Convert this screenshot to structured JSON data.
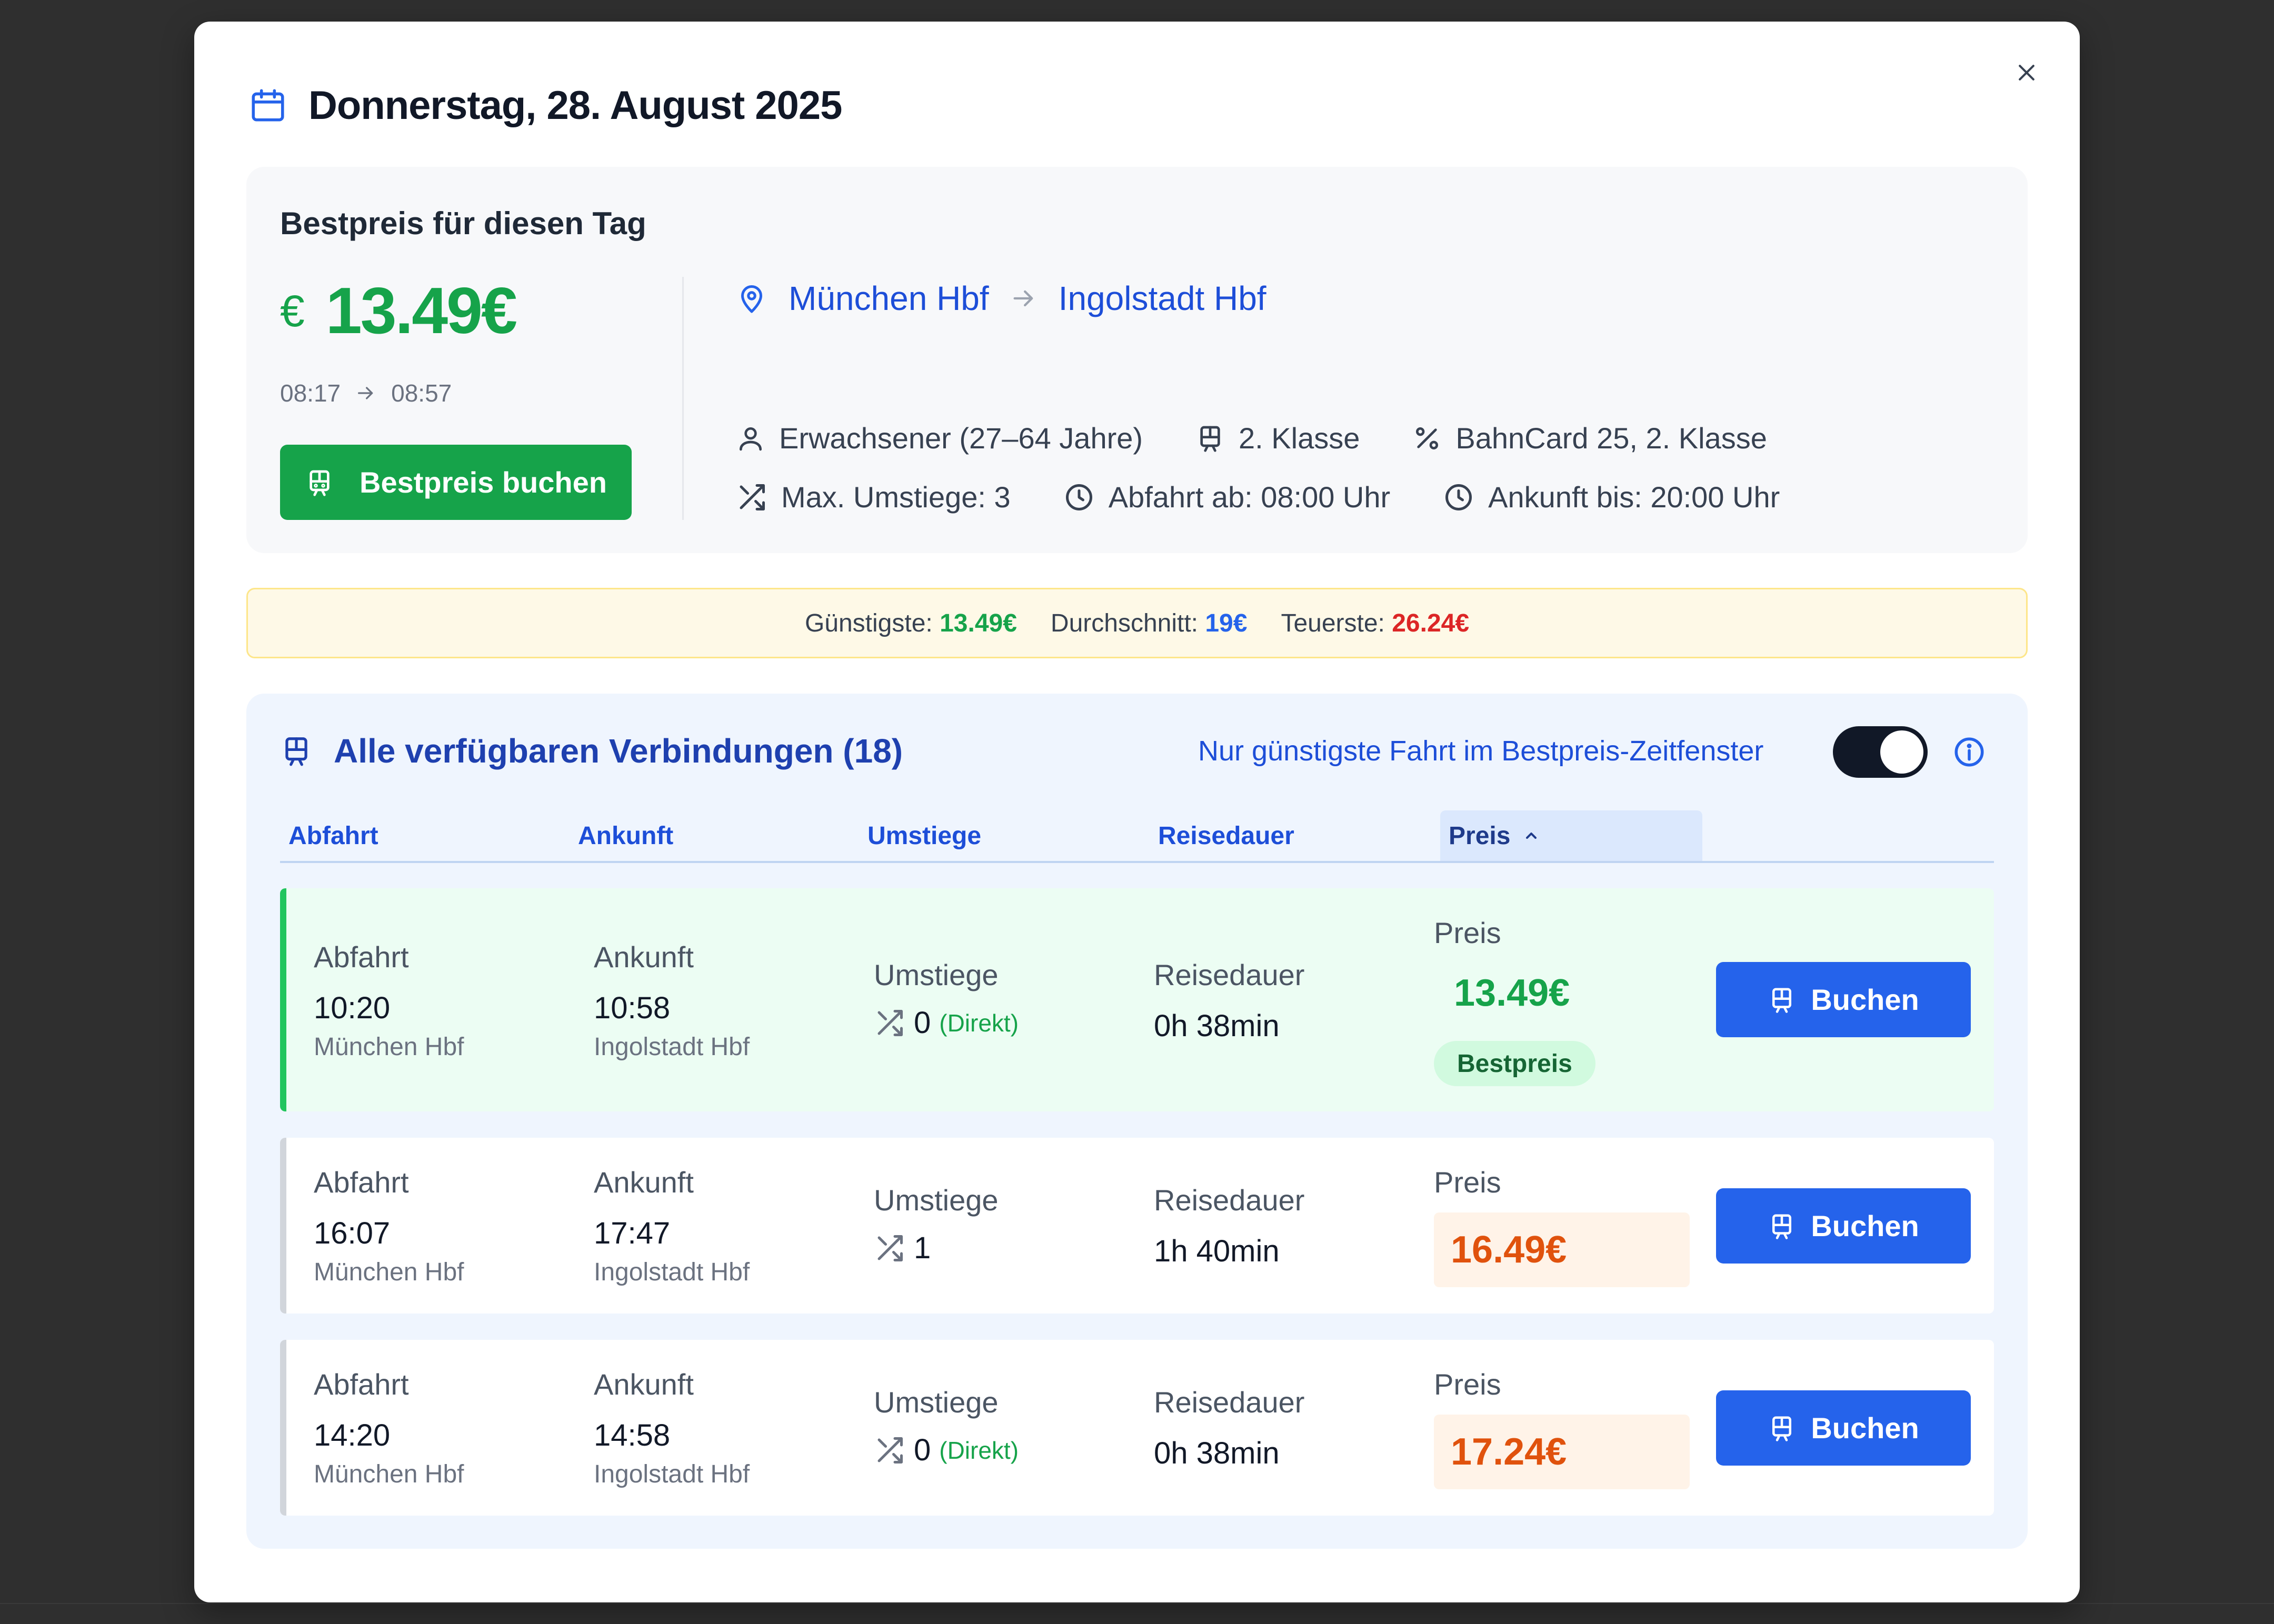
{
  "header": {
    "date_title": "Donnerstag, 28. August 2025"
  },
  "best_price": {
    "heading": "Bestpreis für diesen Tag",
    "currency_symbol": "€",
    "price": "13.49€",
    "departure": "08:17",
    "arrival": "08:57",
    "book_label": "Bestpreis buchen"
  },
  "route": {
    "from": "München Hbf",
    "to": "Ingolstadt Hbf"
  },
  "meta": {
    "passenger": "Erwachsener (27–64 Jahre)",
    "class": "2. Klasse",
    "discount": "BahnCard 25, 2. Klasse",
    "max_transfers": "Max. Umstiege: 3",
    "departure_from": "Abfahrt ab: 08:00 Uhr",
    "arrival_until": "Ankunft bis: 20:00 Uhr"
  },
  "stats": {
    "lowest_label": "Günstigste:",
    "lowest_value": "13.49€",
    "average_label": "Durchschnitt:",
    "average_value": "19€",
    "highest_label": "Teuerste:",
    "highest_value": "26.24€"
  },
  "connections": {
    "title": "Alle verfügbaren Verbindungen (18)",
    "toggle_label": "Nur günstigste Fahrt im Bestpreis-Zeitfenster",
    "toggle_on": true,
    "columns": {
      "departure": "Abfahrt",
      "arrival": "Ankunft",
      "transfers": "Umstiege",
      "duration": "Reisedauer",
      "price": "Preis"
    },
    "sort_indicator": "^",
    "labels": {
      "departure": "Abfahrt",
      "arrival": "Ankunft",
      "transfers": "Umstiege",
      "duration": "Reisedauer",
      "price": "Preis",
      "book": "Buchen",
      "best_badge": "Bestpreis"
    },
    "rows": [
      {
        "dep_time": "10:20",
        "dep_station": "München Hbf",
        "arr_time": "10:58",
        "arr_station": "Ingolstadt Hbf",
        "transfers": "0",
        "transfers_note": "(Direkt)",
        "duration": "0h 38min",
        "price": "13.49€",
        "best": true
      },
      {
        "dep_time": "16:07",
        "dep_station": "München Hbf",
        "arr_time": "17:47",
        "arr_station": "Ingolstadt Hbf",
        "transfers": "1",
        "transfers_note": "",
        "duration": "1h 40min",
        "price": "16.49€",
        "best": false
      },
      {
        "dep_time": "14:20",
        "dep_station": "München Hbf",
        "arr_time": "14:58",
        "arr_station": "Ingolstadt Hbf",
        "transfers": "0",
        "transfers_note": "(Direkt)",
        "duration": "0h 38min",
        "price": "17.24€",
        "best": false
      }
    ]
  },
  "colors": {
    "accent_blue": "#2563eb",
    "best_green": "#16a34a",
    "price_orange": "#e0520d",
    "expensive_red": "#dc2626"
  },
  "icons": [
    "calendar-icon",
    "close-icon",
    "train-icon",
    "map-pin-icon",
    "arrow-right-icon",
    "user-icon",
    "percent-icon",
    "shuffle-icon",
    "clock-icon",
    "info-icon",
    "chevron-up-icon"
  ]
}
